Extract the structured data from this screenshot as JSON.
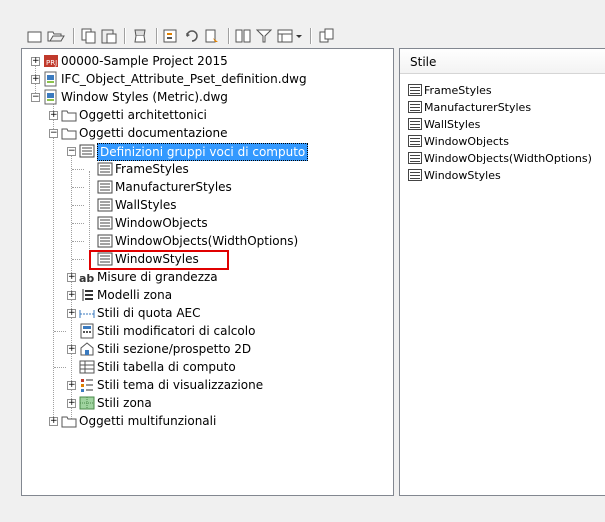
{
  "toolbar": {
    "buttons": [
      "new-icon",
      "open-icon",
      "copy-icon",
      "paste-icon",
      "purge-icon",
      "properties-icon",
      "refresh-icon",
      "style-icon",
      "compare-icon",
      "filter-icon",
      "view-icon",
      "dropdown-icon",
      "export-icon"
    ]
  },
  "tree": {
    "items": [
      {
        "label": "00000-Sample Project 2015",
        "icon": "project-icon"
      },
      {
        "label": "IFC_Object_Attribute_Pset_definition.dwg",
        "icon": "drawing-icon"
      },
      {
        "label": "Window Styles (Metric).dwg",
        "icon": "drawing-icon"
      },
      {
        "label": "Oggetti architettonici",
        "icon": "folder-icon"
      },
      {
        "label": "Oggetti documentazione",
        "icon": "folder-icon"
      },
      {
        "label": "Definizioni gruppi voci di computo",
        "icon": "list-icon"
      },
      {
        "label": "FrameStyles",
        "icon": "list-icon"
      },
      {
        "label": "ManufacturerStyles",
        "icon": "list-icon"
      },
      {
        "label": "WallStyles",
        "icon": "list-icon"
      },
      {
        "label": "WindowObjects",
        "icon": "list-icon"
      },
      {
        "label": "WindowObjects(WidthOptions)",
        "icon": "list-icon"
      },
      {
        "label": "WindowStyles",
        "icon": "list-icon"
      },
      {
        "label": "Misure di grandezza",
        "icon": "ab-icon"
      },
      {
        "label": "Modelli zona",
        "icon": "zone-template-icon"
      },
      {
        "label": "Stili di quota AEC",
        "icon": "dimension-icon"
      },
      {
        "label": "Stili modificatori di calcolo",
        "icon": "calc-icon"
      },
      {
        "label": "Stili sezione/prospetto 2D",
        "icon": "section-icon"
      },
      {
        "label": "Stili tabella di computo",
        "icon": "table-icon"
      },
      {
        "label": "Stili tema di visualizzazione",
        "icon": "theme-icon"
      },
      {
        "label": "Stili zona",
        "icon": "zone-icon"
      },
      {
        "label": "Oggetti multifunzionali",
        "icon": "folder-icon"
      }
    ]
  },
  "panel": {
    "header": "Stile",
    "items": [
      "FrameStyles",
      "ManufacturerStyles",
      "WallStyles",
      "WindowObjects",
      "WindowObjects(WidthOptions)",
      "WindowStyles"
    ]
  },
  "colors": {
    "selection": "#3399ff",
    "highlight": "#e00000"
  }
}
